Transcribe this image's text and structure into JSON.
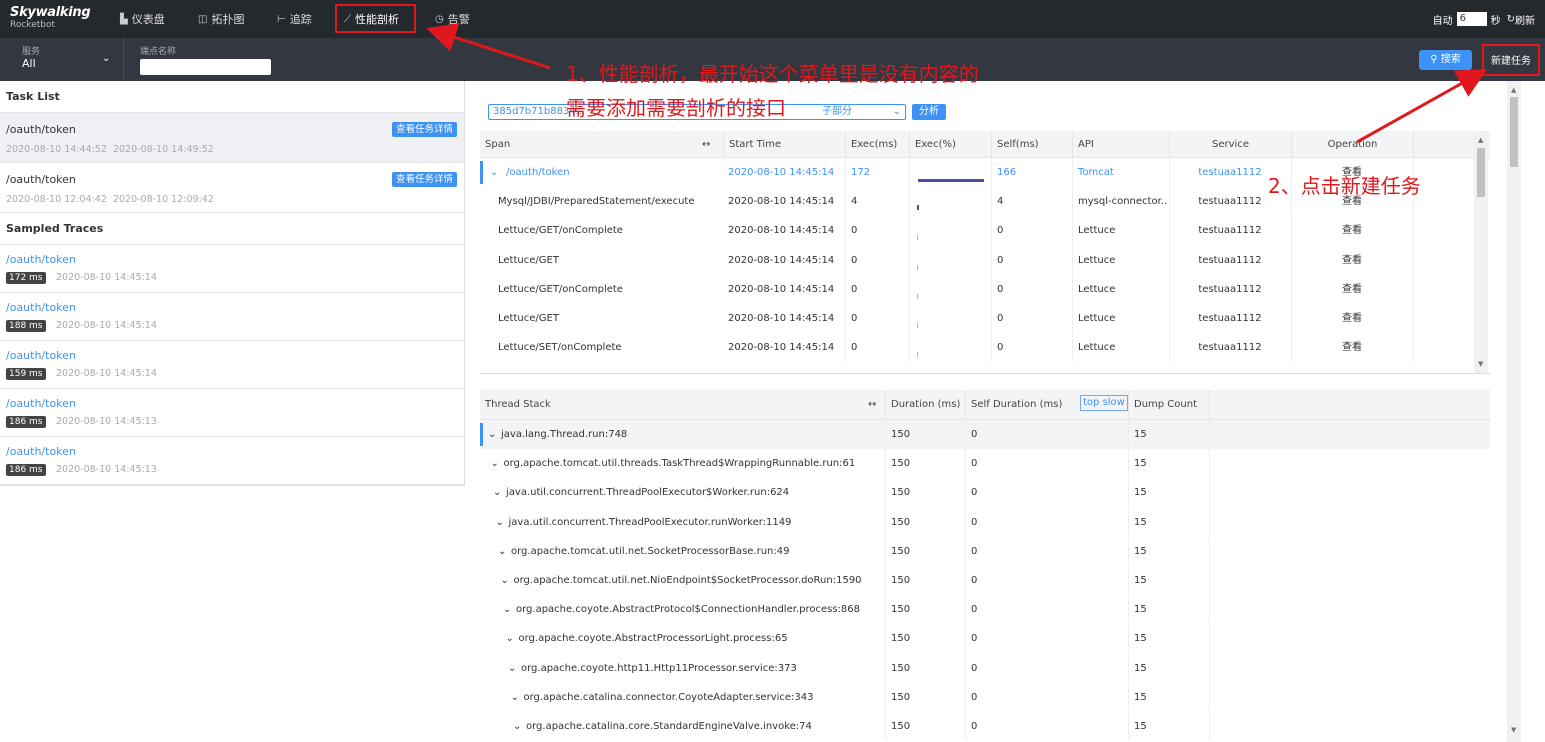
{
  "header": {
    "logo_main": "Skywalking",
    "logo_sub": "Rocketbot",
    "nav": [
      {
        "label": "仪表盘",
        "icon": "bar-chart-icon"
      },
      {
        "label": "拓扑图",
        "icon": "topology-icon"
      },
      {
        "label": "追踪",
        "icon": "trace-icon"
      },
      {
        "label": "性能剖析",
        "icon": "profile-icon"
      },
      {
        "label": "告警",
        "icon": "alarm-icon"
      }
    ],
    "auto_label": "自动",
    "auto_value": "6",
    "sec_label": "秒",
    "refresh_label": "刷新"
  },
  "subbar": {
    "service_label": "服务",
    "service_value": "All",
    "endpoint_label": "端点名称",
    "endpoint_value": "",
    "search_label": "搜索",
    "new_task_label": "新建任务"
  },
  "task_list": {
    "title": "Task List",
    "detail_label": "查看任务详情",
    "items": [
      {
        "name": "/oauth/token",
        "start": "2020-08-10 14:44:52",
        "end": "2020-08-10 14:49:52"
      },
      {
        "name": "/oauth/token",
        "start": "2020-08-10 12:04:42",
        "end": "2020-08-10 12:09:42"
      }
    ]
  },
  "sampled": {
    "title": "Sampled Traces",
    "items": [
      {
        "name": "/oauth/token",
        "duration": "172 ms",
        "time": "2020-08-10 14:45:14"
      },
      {
        "name": "/oauth/token",
        "duration": "188 ms",
        "time": "2020-08-10 14:45:14"
      },
      {
        "name": "/oauth/token",
        "duration": "159 ms",
        "time": "2020-08-10 14:45:14"
      },
      {
        "name": "/oauth/token",
        "duration": "186 ms",
        "time": "2020-08-10 14:45:13"
      },
      {
        "name": "/oauth/token",
        "duration": "186 ms",
        "time": "2020-08-10 14:45:13"
      }
    ]
  },
  "segment": {
    "selected": "385d7b71b8834...",
    "tail": "子部分",
    "analyze_label": "分析"
  },
  "span_table": {
    "headers": {
      "span": "Span",
      "start": "Start Time",
      "exec": "Exec(ms)",
      "exec_pct": "Exec(%)",
      "self": "Self(ms)",
      "api": "API",
      "service": "Service",
      "operation": "Operation"
    },
    "rows": [
      {
        "span": "/oauth/token",
        "start": "2020-08-10 14:45:14",
        "exec": "172",
        "exec_pct": 1.0,
        "self": "166",
        "api": "Tomcat",
        "service": "testuaa1112",
        "op": "查看"
      },
      {
        "span": "Mysql/JDBI/PreparedStatement/execute",
        "start": "2020-08-10 14:45:14",
        "exec": "4",
        "exec_pct": 0.02,
        "self": "4",
        "api": "mysql-connector...",
        "service": "testuaa1112",
        "op": "查看"
      },
      {
        "span": "Lettuce/GET/onComplete",
        "start": "2020-08-10 14:45:14",
        "exec": "0",
        "exec_pct": 0,
        "self": "0",
        "api": "Lettuce",
        "service": "testuaa1112",
        "op": "查看"
      },
      {
        "span": "Lettuce/GET",
        "start": "2020-08-10 14:45:14",
        "exec": "0",
        "exec_pct": 0,
        "self": "0",
        "api": "Lettuce",
        "service": "testuaa1112",
        "op": "查看"
      },
      {
        "span": "Lettuce/GET/onComplete",
        "start": "2020-08-10 14:45:14",
        "exec": "0",
        "exec_pct": 0,
        "self": "0",
        "api": "Lettuce",
        "service": "testuaa1112",
        "op": "查看"
      },
      {
        "span": "Lettuce/GET",
        "start": "2020-08-10 14:45:14",
        "exec": "0",
        "exec_pct": 0,
        "self": "0",
        "api": "Lettuce",
        "service": "testuaa1112",
        "op": "查看"
      },
      {
        "span": "Lettuce/SET/onComplete",
        "start": "2020-08-10 14:45:14",
        "exec": "0",
        "exec_pct": 0,
        "self": "0",
        "api": "Lettuce",
        "service": "testuaa1112",
        "op": "查看"
      }
    ]
  },
  "thread_table": {
    "headers": {
      "stack": "Thread Stack",
      "duration": "Duration (ms)",
      "self": "Self Duration (ms)",
      "top_slow": "top slow",
      "dump": "Dump Count"
    },
    "rows": [
      {
        "name": "java.lang.Thread.run:748",
        "duration": "150",
        "self": "0",
        "dump": "15"
      },
      {
        "name": "org.apache.tomcat.util.threads.TaskThread$WrappingRunnable.run:61",
        "duration": "150",
        "self": "0",
        "dump": "15"
      },
      {
        "name": "java.util.concurrent.ThreadPoolExecutor$Worker.run:624",
        "duration": "150",
        "self": "0",
        "dump": "15"
      },
      {
        "name": "java.util.concurrent.ThreadPoolExecutor.runWorker:1149",
        "duration": "150",
        "self": "0",
        "dump": "15"
      },
      {
        "name": "org.apache.tomcat.util.net.SocketProcessorBase.run:49",
        "duration": "150",
        "self": "0",
        "dump": "15"
      },
      {
        "name": "org.apache.tomcat.util.net.NioEndpoint$SocketProcessor.doRun:1590",
        "duration": "150",
        "self": "0",
        "dump": "15"
      },
      {
        "name": "org.apache.coyote.AbstractProtocol$ConnectionHandler.process:868",
        "duration": "150",
        "self": "0",
        "dump": "15"
      },
      {
        "name": "org.apache.coyote.AbstractProcessorLight.process:65",
        "duration": "150",
        "self": "0",
        "dump": "15"
      },
      {
        "name": "org.apache.coyote.http11.Http11Processor.service:373",
        "duration": "150",
        "self": "0",
        "dump": "15"
      },
      {
        "name": "org.apache.catalina.connector.CoyoteAdapter.service:343",
        "duration": "150",
        "self": "0",
        "dump": "15"
      },
      {
        "name": "org.apache.catalina.core.StandardEngineValve.invoke:74",
        "duration": "150",
        "self": "0",
        "dump": "15"
      }
    ]
  },
  "annotations": {
    "note1_line1": "1、性能剖析，最开始这个菜单里是没有内容的",
    "note1_line2": "需要添加需要剖析的接口",
    "note2": "2、点击新建任务"
  },
  "colors": {
    "accent": "#3d92f5",
    "annotation": "#e0181d",
    "topbar": "#24292e",
    "subbar": "#333840"
  }
}
